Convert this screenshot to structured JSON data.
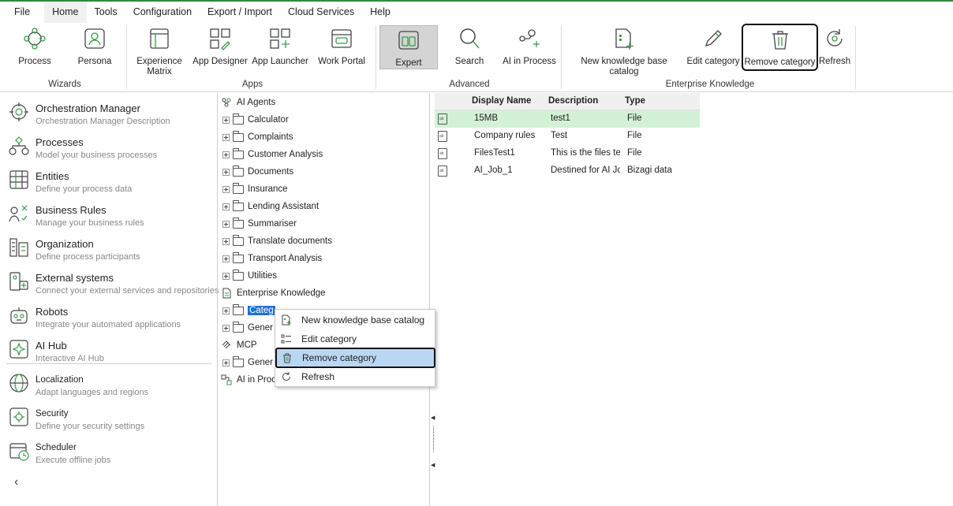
{
  "menu": {
    "items": [
      "File",
      "Home",
      "Tools",
      "Configuration",
      "Export / Import",
      "Cloud Services",
      "Help"
    ]
  },
  "ribbon": {
    "buttons": {
      "process": "Process",
      "persona": "Persona",
      "experience_matrix_1": "Experience",
      "experience_matrix_2": "Matrix",
      "app_designer": "App Designer",
      "app_launcher": "App Launcher",
      "work_portal": "Work Portal",
      "expert": "Expert",
      "search": "Search",
      "ai_in_process": "AI in Process",
      "new_kb_catalog": "New knowledge base catalog",
      "edit_category": "Edit category",
      "remove_category": "Remove category",
      "refresh": "Refresh"
    },
    "groups": {
      "wizards": "Wizards",
      "apps": "Apps",
      "advanced": "Advanced",
      "enterprise_knowledge": "Enterprise Knowledge"
    }
  },
  "leftnav": {
    "items": [
      {
        "title": "Orchestration Manager",
        "desc": "Orchestration Manager Description",
        "icon": "orchestration-icon"
      },
      {
        "title": "Processes",
        "desc": "Model your business processes",
        "icon": "processes-icon"
      },
      {
        "title": "Entities",
        "desc": "Define your process data",
        "icon": "entities-icon"
      },
      {
        "title": "Business Rules",
        "desc": "Manage your business rules",
        "icon": "business-rules-icon"
      },
      {
        "title": "Organization",
        "desc": "Define process participants",
        "icon": "organization-icon"
      },
      {
        "title": "External systems",
        "desc": "Connect your external services and repositories",
        "icon": "external-systems-icon"
      },
      {
        "title": "Robots",
        "desc": "Integrate your automated applications",
        "icon": "robot-icon"
      },
      {
        "title": "AI Hub",
        "desc": "Interactive AI Hub",
        "icon": "ai-hub-icon"
      },
      {
        "title": "Localization",
        "desc": "Adapt languages and regions",
        "icon": "localization-icon"
      },
      {
        "title": "Security",
        "desc": "Define your security settings",
        "icon": "security-icon"
      },
      {
        "title": "Scheduler",
        "desc": "Execute offline jobs",
        "icon": "scheduler-icon"
      }
    ],
    "collapse_glyph": "‹"
  },
  "tree": {
    "ai_agents": "AI Agents",
    "agents": [
      "Calculator",
      "Complaints",
      "Customer Analysis",
      "Documents",
      "Insurance",
      "Lending Assistant",
      "Summariser",
      "Translate documents",
      "Transport Analysis",
      "Utilities"
    ],
    "enterprise_knowledge": "Enterprise Knowledge",
    "ek_children": [
      "Categ",
      "Gener"
    ],
    "mcp": "MCP",
    "mcp_children": [
      "Gener"
    ],
    "ai_in_process": "AI in Proce"
  },
  "list": {
    "headers": {
      "name": "Display Name",
      "description": "Description",
      "type": "Type"
    },
    "rows": [
      {
        "name": "15MB",
        "description": "test1",
        "type": "File",
        "selected": true
      },
      {
        "name": "Company rules",
        "description": "Test",
        "type": "File",
        "selected": false
      },
      {
        "name": "FilesTest1",
        "description": "This is the files te",
        "type": "File",
        "selected": false
      },
      {
        "name": "AI_Job_1",
        "description": "Destined for AI Jo",
        "type": "Bizagi data",
        "selected": false
      }
    ]
  },
  "context_menu": {
    "items": [
      "New knowledge base catalog",
      "Edit category",
      "Remove category",
      "Refresh"
    ],
    "highlighted_index": 2
  },
  "colors": {
    "accent": "#2f8a3d",
    "icon_green": "#3a9a4a",
    "selected_row": "#d3f1d6",
    "menu_highlight": "#b9d7f2",
    "tree_selection": "#1d72d6"
  }
}
